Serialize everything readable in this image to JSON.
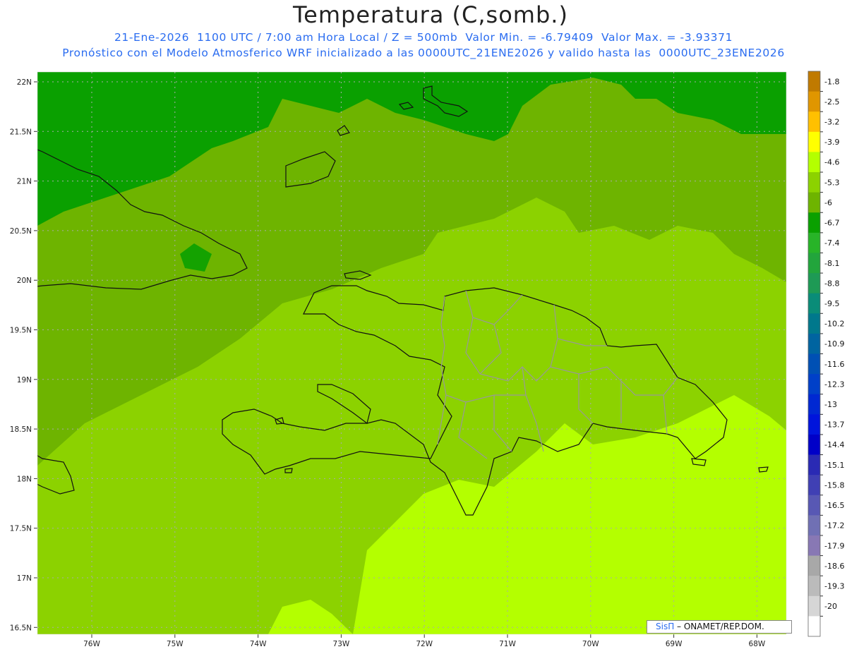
{
  "title": "Temperatura (C,somb.)",
  "subtitle_line1": "21-Ene-2026  1100 UTC / 7:00 am Hora Local / Z = 500mb  Valor Min. = -6.79409  Valor Max. = -3.93371",
  "subtitle_line2": "Pronóstico con el Modelo Atmosferico WRF inicializado a las 0000UTC_21ENE2026 y valido hasta las  0000UTC_23ENE2026",
  "credit": {
    "brand": "SisΠ",
    "text": " – ONAMET/REP.DOM."
  },
  "lat_labels": [
    "22N",
    "21.5N",
    "21N",
    "20.5N",
    "20N",
    "19.5N",
    "19N",
    "18.5N",
    "18N",
    "17.5N",
    "17N",
    "16.5N"
  ],
  "lon_labels": [
    "76W",
    "75W",
    "74W",
    "73W",
    "72W",
    "71W",
    "70W",
    "69W",
    "68W"
  ],
  "colorbar": {
    "labels": [
      "-1.8",
      "-2.5",
      "-3.2",
      "-3.9",
      "-4.6",
      "-5.3",
      "-6",
      "-6.7",
      "-7.4",
      "-8.1",
      "-8.8",
      "-9.5",
      "-10.2",
      "-10.9",
      "-11.6",
      "-12.3",
      "-13",
      "-13.7",
      "-14.4",
      "-15.1",
      "-15.8",
      "-16.5",
      "-17.2",
      "-17.9",
      "-18.6",
      "-19.3",
      "-20"
    ],
    "colors": [
      "#c07a00",
      "#e09600",
      "#ffc000",
      "#ffff00",
      "#b4ff00",
      "#8cd200",
      "#6eb400",
      "#0aa000",
      "#28b428",
      "#22a53c",
      "#1e9a55",
      "#0a8c78",
      "#00788c",
      "#0064a0",
      "#0050b4",
      "#0040c8",
      "#0028d2",
      "#0014dc",
      "#0000c8",
      "#2a2ab4",
      "#4040b4",
      "#5858b4",
      "#7070b4",
      "#8878b4",
      "#a8a8a8",
      "#bbbbbb",
      "#d6d6d6",
      "#ffffff"
    ]
  },
  "field_colors": {
    "dark": "#0aa000",
    "mid": "#6eb400",
    "light": "#8cd200",
    "lightest": "#b4ff00"
  }
}
